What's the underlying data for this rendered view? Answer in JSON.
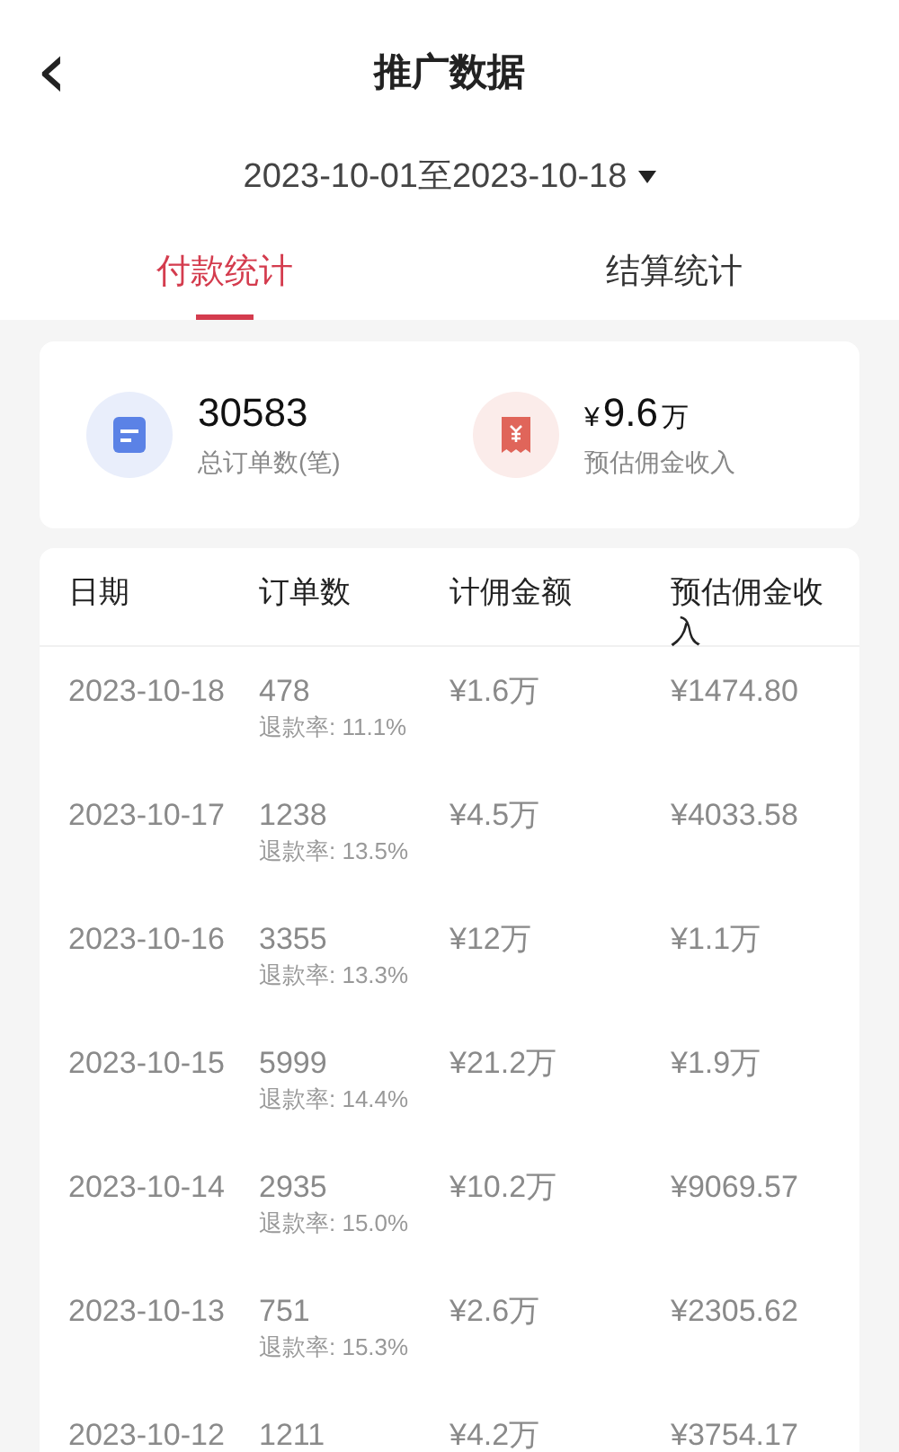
{
  "header": {
    "back": "‹",
    "title": "推广数据"
  },
  "date_range": {
    "text": "2023-10-01至2023-10-18"
  },
  "tabs": [
    {
      "label": "付款统计",
      "selected": true
    },
    {
      "label": "结算统计",
      "selected": false
    }
  ],
  "summary": [
    {
      "kind": "orders",
      "value": "30583",
      "label": "总订单数(笔)"
    },
    {
      "kind": "income",
      "currency": "¥",
      "value": "9.6",
      "unit": "万",
      "label": "预估佣金收入"
    }
  ],
  "table": {
    "columns": [
      "日期",
      "订单数",
      "计佣金额",
      "预估佣金收入"
    ],
    "rows": [
      {
        "date": "2023-10-18",
        "orders": "478",
        "refund": "退款率: 11.1%",
        "amount": "¥1.6万",
        "income": "¥1474.80"
      },
      {
        "date": "2023-10-17",
        "orders": "1238",
        "refund": "退款率: 13.5%",
        "amount": "¥4.5万",
        "income": "¥4033.58"
      },
      {
        "date": "2023-10-16",
        "orders": "3355",
        "refund": "退款率: 13.3%",
        "amount": "¥12万",
        "income": "¥1.1万"
      },
      {
        "date": "2023-10-15",
        "orders": "5999",
        "refund": "退款率: 14.4%",
        "amount": "¥21.2万",
        "income": "¥1.9万"
      },
      {
        "date": "2023-10-14",
        "orders": "2935",
        "refund": "退款率: 15.0%",
        "amount": "¥10.2万",
        "income": "¥9069.57"
      },
      {
        "date": "2023-10-13",
        "orders": "751",
        "refund": "退款率: 15.3%",
        "amount": "¥2.6万",
        "income": "¥2305.62"
      },
      {
        "date": "2023-10-12",
        "orders": "1211",
        "amount": "¥4.2万",
        "income": "¥3754.17"
      }
    ]
  }
}
